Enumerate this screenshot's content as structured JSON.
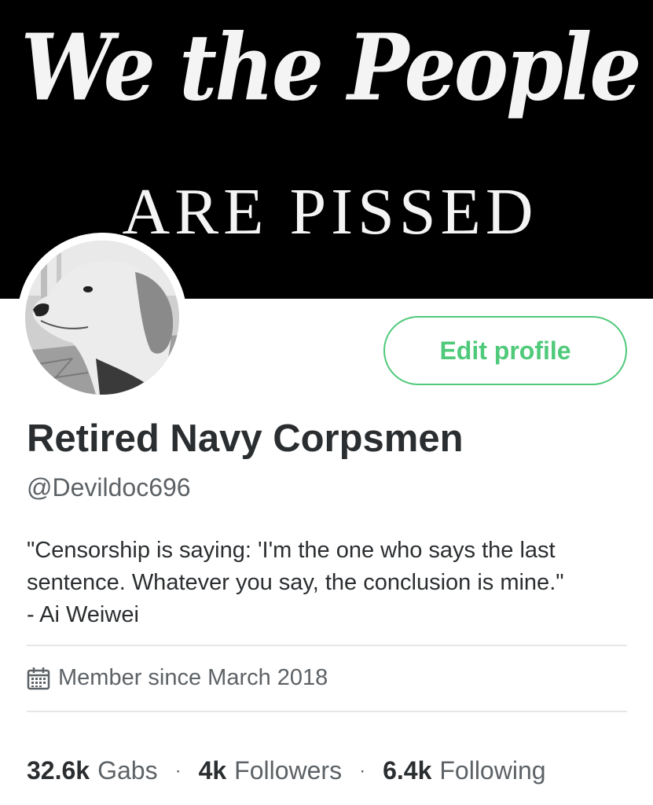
{
  "banner": {
    "script_text": "We the People",
    "sub_text": "ARE PISSED"
  },
  "actions": {
    "edit_label": "Edit profile"
  },
  "profile": {
    "name": "Retired Navy Corpsmen",
    "handle": "@Devildoc696",
    "bio": "\"Censorship is saying: 'I'm the one who says the last\nsentence. Whatever you say, the conclusion is mine.\"\n- Ai Weiwei",
    "member_since": "Member since March 2018"
  },
  "stats": [
    {
      "value": "32.6k",
      "label": "Gabs"
    },
    {
      "value": "4k",
      "label": "Followers"
    },
    {
      "value": "6.4k",
      "label": "Following"
    }
  ],
  "stat_separator": "·",
  "colors": {
    "accent": "#4fc97a",
    "text": "#2b2e30",
    "muted": "#5d6266",
    "divider": "#e6e7e8"
  },
  "icons": {
    "member_since": "calendar-icon"
  }
}
